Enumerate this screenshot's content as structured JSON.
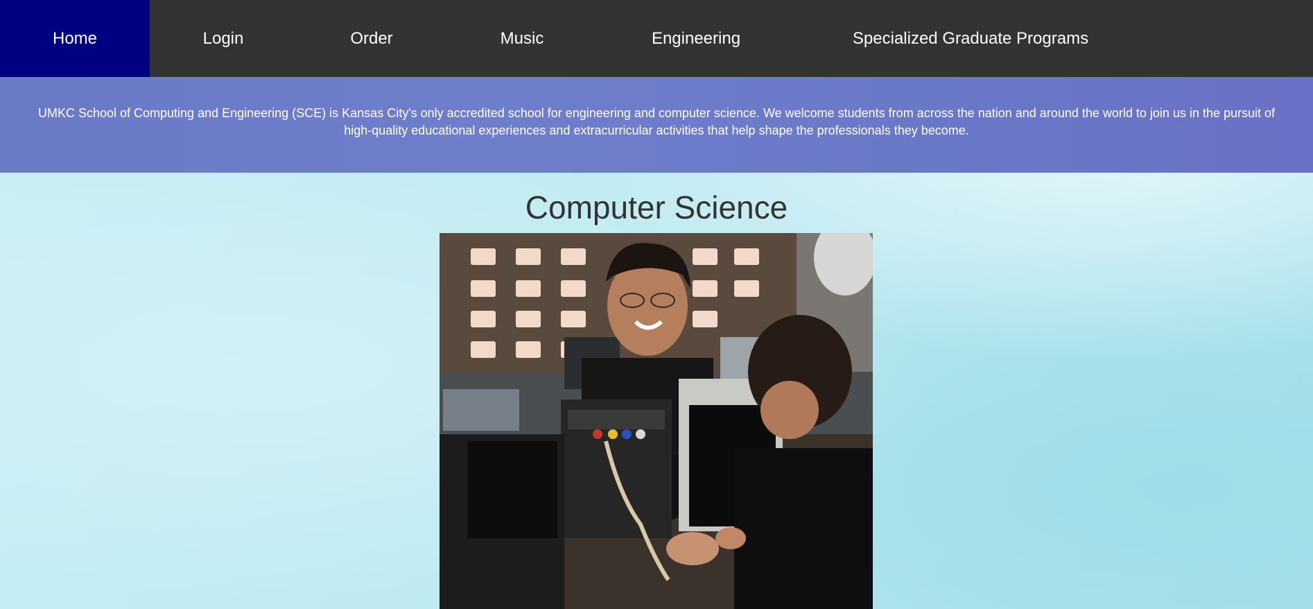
{
  "nav": {
    "items": [
      {
        "label": "Home",
        "active": true
      },
      {
        "label": "Login",
        "active": false
      },
      {
        "label": "Order",
        "active": false
      },
      {
        "label": "Music",
        "active": false
      },
      {
        "label": "Engineering",
        "active": false
      },
      {
        "label": "Specialized Graduate Programs",
        "active": false
      }
    ]
  },
  "banner": {
    "text": "UMKC School of Computing and Engineering (SCE) is Kansas City's only accredited school for engineering and computer science. We welcome students from across the nation and around the world to join us in the pursuit of high-quality educational experiences and extracurricular activities that help shape the professionals they become."
  },
  "main": {
    "title": "Computer Science",
    "photo_subject": "students-in-computer-lab"
  },
  "colors": {
    "nav_bg": "#333333",
    "nav_active": "#000080",
    "banner_bg": "#6a7ac6",
    "title_text": "#333333"
  }
}
